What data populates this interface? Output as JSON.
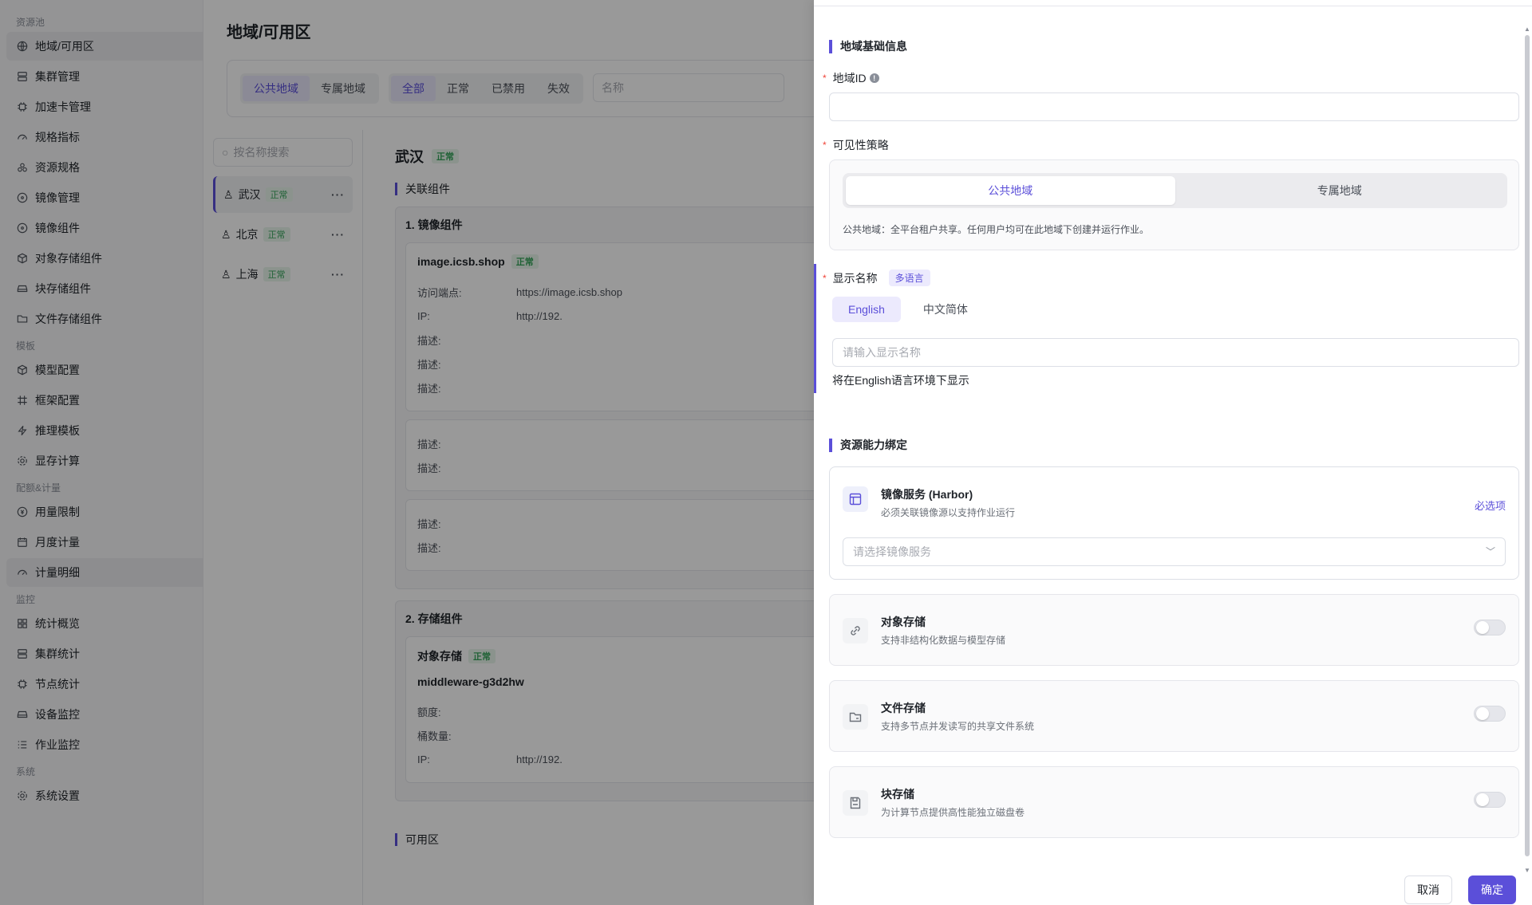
{
  "sidebar": {
    "groups": [
      {
        "title": "资源池",
        "items": [
          {
            "label": "地域/可用区",
            "icon": "globe-icon",
            "active": true
          },
          {
            "label": "集群管理",
            "icon": "server-icon"
          },
          {
            "label": "加速卡管理",
            "icon": "chip-icon"
          },
          {
            "label": "规格指标",
            "icon": "gauge-icon"
          },
          {
            "label": "资源规格",
            "icon": "cubes-icon"
          },
          {
            "label": "镜像管理",
            "icon": "disc-icon"
          },
          {
            "label": "镜像组件",
            "icon": "disc-icon"
          },
          {
            "label": "对象存储组件",
            "icon": "box-icon"
          },
          {
            "label": "块存储组件",
            "icon": "drive-icon"
          },
          {
            "label": "文件存储组件",
            "icon": "folder-icon"
          }
        ]
      },
      {
        "title": "模板",
        "items": [
          {
            "label": "模型配置",
            "icon": "box-icon"
          },
          {
            "label": "框架配置",
            "icon": "hash-icon"
          },
          {
            "label": "推理模板",
            "icon": "bolt-icon"
          },
          {
            "label": "显存计算",
            "icon": "gear-icon"
          }
        ]
      },
      {
        "title": "配额&计量",
        "items": [
          {
            "label": "用量限制",
            "icon": "coin-icon"
          },
          {
            "label": "月度计量",
            "icon": "calendar-icon"
          },
          {
            "label": "计量明细",
            "icon": "gauge-icon",
            "active": true
          }
        ]
      },
      {
        "title": "监控",
        "items": [
          {
            "label": "统计概览",
            "icon": "grid-icon"
          },
          {
            "label": "集群统计",
            "icon": "server-icon"
          },
          {
            "label": "节点统计",
            "icon": "chip-icon"
          },
          {
            "label": "设备监控",
            "icon": "drive-icon"
          },
          {
            "label": "作业监控",
            "icon": "list-icon"
          }
        ]
      },
      {
        "title": "系统",
        "items": [
          {
            "label": "系统设置",
            "icon": "gear-icon"
          }
        ]
      }
    ]
  },
  "main": {
    "title": "地域/可用区",
    "scope_tabs": [
      "公共地域",
      "专属地域"
    ],
    "status_tabs": [
      "全部",
      "正常",
      "已禁用",
      "失效"
    ],
    "name_placeholder": "名称",
    "search_placeholder": "按名称搜索",
    "regions": [
      {
        "name": "武汉",
        "status": "正常"
      },
      {
        "name": "北京",
        "status": "正常"
      },
      {
        "name": "上海",
        "status": "正常"
      }
    ],
    "detail": {
      "name": "武汉",
      "status": "正常",
      "section": "关联组件",
      "group1": "1. 镜像组件",
      "image_host": "image.icsb.shop",
      "image_status": "正常",
      "endpoint_label": "访问端点:",
      "endpoint_value": "https://image.icsb.shop",
      "ip_label": "IP:",
      "ip_value": "http://192.",
      "desc_label": "描述:",
      "group2": "2. 存储组件",
      "obj_title": "对象存储",
      "obj_status": "正常",
      "obj_name": "middleware-g3d2hw",
      "quota_label": "额度:",
      "bucket_label": "桶数量:",
      "az_section": "可用区"
    }
  },
  "drawer": {
    "basic_section": "地域基础信息",
    "region_id_label": "地域ID",
    "visibility_label": "可见性策略",
    "vis_options": [
      "公共地域",
      "专属地域"
    ],
    "vis_hint": "公共地域：全平台租户共享。任何用户均可在此地域下创建并运行作业。",
    "display_name_label": "显示名称",
    "multi_lang_tag": "多语言",
    "lang_tabs": [
      "English",
      "中文简体"
    ],
    "display_name_placeholder": "请输入显示名称",
    "lang_note": "将在English语言环境下显示",
    "resource_section": "资源能力绑定",
    "resources": [
      {
        "title": "镜像服务 (Harbor)",
        "sub": "必须关联镜像源以支持作业运行",
        "icon": "layout-icon"
      },
      {
        "title": "对象存储",
        "sub": "支持非结构化数据与模型存储",
        "icon": "link-icon"
      },
      {
        "title": "文件存储",
        "sub": "支持多节点并发读写的共享文件系统",
        "icon": "folder-icon"
      },
      {
        "title": "块存储",
        "sub": "为计算节点提供高性能独立磁盘卷",
        "icon": "save-icon"
      }
    ],
    "required_link": "必选项",
    "mirror_placeholder": "请选择镜像服务",
    "cancel": "取消",
    "confirm": "确定"
  },
  "colors": {
    "accent": "#5b4fd9",
    "success": "#36a35a",
    "required": "#f04438"
  }
}
